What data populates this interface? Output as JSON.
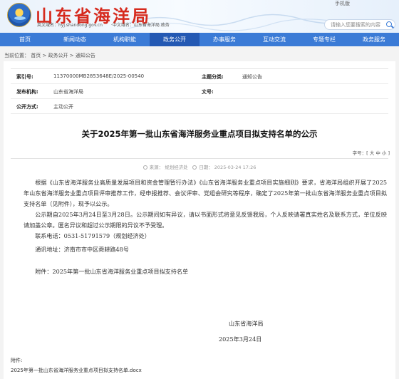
{
  "header": {
    "title": "山东省海洋局",
    "subtitle": "英文域名：hyj.shandong.gov.cn　　·中文域名：山东省海洋局.政务",
    "top_links": "手机版",
    "search_placeholder": "请输入您要搜索的内容"
  },
  "nav": [
    "首页",
    "新闻动态",
    "机构职能",
    "政务公开",
    "办事服务",
    "互动交流",
    "专题专栏",
    "政务服务"
  ],
  "breadcrumb": "当前位置： 首页 > 政务公开 > 通知公告",
  "meta": {
    "index_label": "索引号:",
    "index_value": "11370000MB2853648E/2025-00540",
    "category_label": "主题分类:",
    "category_value": "通知公告",
    "org_label": "发布机构:",
    "org_value": "山东省海洋局",
    "doc_label": "文号:",
    "doc_value": "",
    "open_label": "公开方式:",
    "open_value": "主动公开"
  },
  "article": {
    "title": "关于2025年第一批山东省海洋服务业重点项目拟支持名单的公示",
    "font_size_label": "字号：[ 大 中 小 ]",
    "source": "来源： 规划经济处",
    "date": "日期： 2025-03-24 17:26",
    "p1": "根据《山东省海洋服务业高质量发展项目和资金管理暂行办法》《山东省海洋服务业重点项目实施细则》要求，省海洋局组织开展了2025年山东省海洋服务业重点项目评审推荐工作，经申报推荐、会议评审、党组会研究等程序，确定了2025年第一批山东省海洋服务业重点项目拟支持名单（见附件），现予以公示。",
    "p2": "公示期自2025年3月24日至3月28日。公示期间如有异议，请以书面形式将意见反馈我局，个人反映请署真实姓名及联系方式，单位反映请加盖公章。匿名异议和超过公示期限的异议不予受理。",
    "contact_phone": "联系电话：0531-51791579（规划经济处）",
    "contact_addr": "通讯地址：济南市市中区舜耕路48号",
    "attachment_note": "附件：2025年第一批山东省海洋服务业重点项目拟支持名单",
    "signer": "山东省海洋局",
    "sign_date": "2025年3月24日",
    "attachment_label": "附件:",
    "attachment_file": "2025年第一批山东省海洋服务业重点项目拟支持名单.docx"
  }
}
